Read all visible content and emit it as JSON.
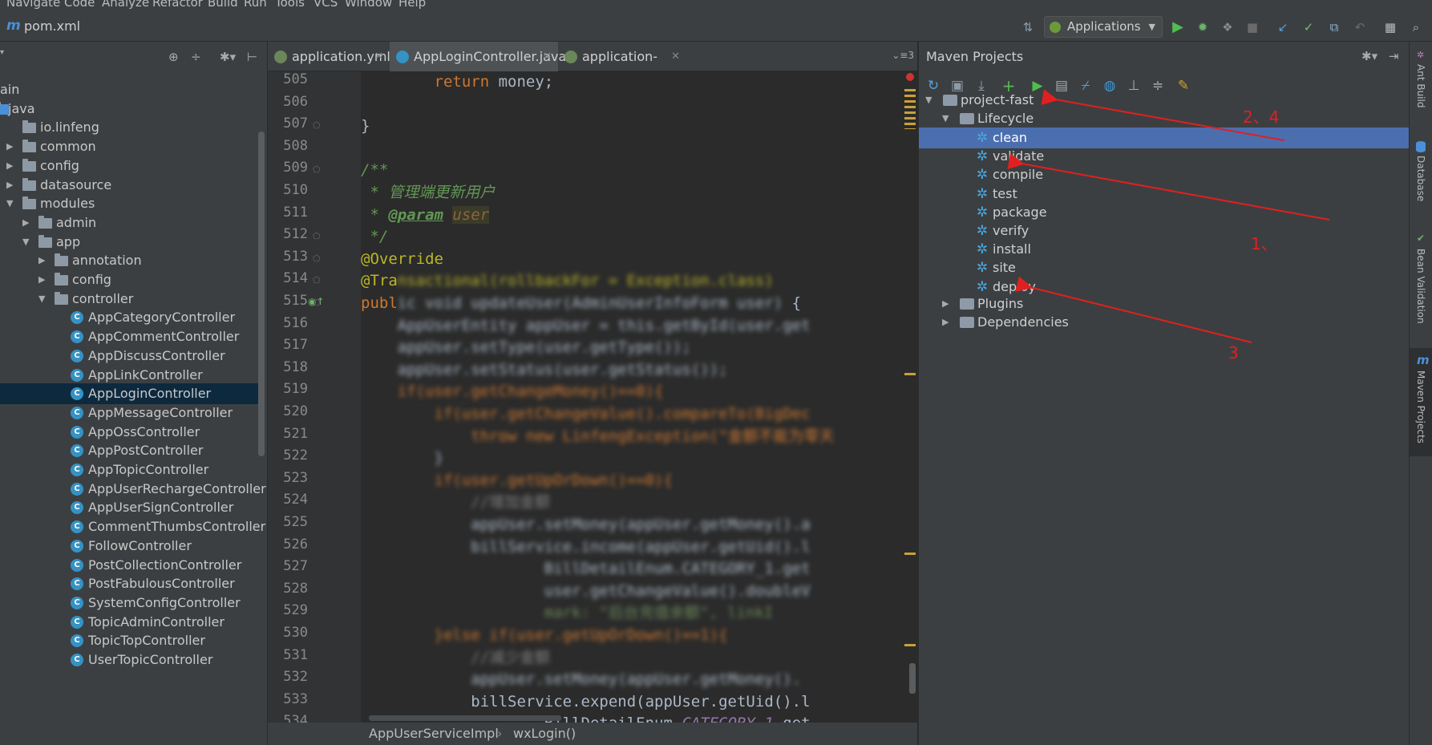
{
  "menu": [
    "Navigate",
    "Code",
    "Analyze",
    "Refactor",
    "Build",
    "Run",
    "Tools",
    "VCS",
    "Window",
    "Help"
  ],
  "navbar": {
    "breadcrumb": "pom.xml",
    "run_config": "Applications"
  },
  "project_tree": [
    {
      "label": "ain",
      "level": 0,
      "type": "text",
      "expanded": null
    },
    {
      "label": "java",
      "level": 0,
      "type": "folder",
      "expanded": null
    },
    {
      "label": "io.linfeng",
      "level": 1,
      "type": "folder",
      "expanded": null
    },
    {
      "label": "common",
      "level": 1,
      "type": "folder",
      "expanded": false
    },
    {
      "label": "config",
      "level": 1,
      "type": "folder",
      "expanded": false
    },
    {
      "label": "datasource",
      "level": 1,
      "type": "folder",
      "expanded": false
    },
    {
      "label": "modules",
      "level": 1,
      "type": "folder",
      "expanded": true
    },
    {
      "label": "admin",
      "level": 2,
      "type": "folder",
      "expanded": false
    },
    {
      "label": "app",
      "level": 2,
      "type": "folder",
      "expanded": true
    },
    {
      "label": "annotation",
      "level": 3,
      "type": "folder",
      "expanded": false
    },
    {
      "label": "config",
      "level": 3,
      "type": "folder",
      "expanded": false
    },
    {
      "label": "controller",
      "level": 3,
      "type": "folder",
      "expanded": true
    },
    {
      "label": "AppCategoryController",
      "level": 4,
      "type": "class"
    },
    {
      "label": "AppCommentController",
      "level": 4,
      "type": "class"
    },
    {
      "label": "AppDiscussController",
      "level": 4,
      "type": "class"
    },
    {
      "label": "AppLinkController",
      "level": 4,
      "type": "class"
    },
    {
      "label": "AppLoginController",
      "level": 4,
      "type": "class",
      "selected": true
    },
    {
      "label": "AppMessageController",
      "level": 4,
      "type": "class"
    },
    {
      "label": "AppOssController",
      "level": 4,
      "type": "class"
    },
    {
      "label": "AppPostController",
      "level": 4,
      "type": "class"
    },
    {
      "label": "AppTopicController",
      "level": 4,
      "type": "class"
    },
    {
      "label": "AppUserRechargeController",
      "level": 4,
      "type": "class"
    },
    {
      "label": "AppUserSignController",
      "level": 4,
      "type": "class"
    },
    {
      "label": "CommentThumbsController",
      "level": 4,
      "type": "class"
    },
    {
      "label": "FollowController",
      "level": 4,
      "type": "class"
    },
    {
      "label": "PostCollectionController",
      "level": 4,
      "type": "class"
    },
    {
      "label": "PostFabulousController",
      "level": 4,
      "type": "class"
    },
    {
      "label": "SystemConfigController",
      "level": 4,
      "type": "class"
    },
    {
      "label": "TopicAdminController",
      "level": 4,
      "type": "class"
    },
    {
      "label": "TopicTopController",
      "level": 4,
      "type": "class"
    },
    {
      "label": "UserTopicController",
      "level": 4,
      "type": "class"
    }
  ],
  "editor_tabs": [
    {
      "label": "application.yml",
      "icon_color": "#6a8759"
    },
    {
      "label": "AppLoginController.java",
      "icon_color": "#3592c4",
      "active": true
    },
    {
      "label": "application-dev.yml",
      "icon_color": "#6a8759"
    }
  ],
  "tab_overflow": "3",
  "line_numbers": [
    505,
    506,
    507,
    508,
    509,
    510,
    511,
    512,
    513,
    514,
    515,
    516,
    517,
    518,
    519,
    520,
    521,
    522,
    523,
    524,
    525,
    526,
    527,
    528,
    529,
    530,
    531,
    532,
    533,
    534
  ],
  "code_lines": [
    {
      "segments": [
        {
          "t": "        return ",
          "c": "#cc7832"
        },
        {
          "t": "money;",
          "c": "#a9b7c6"
        }
      ]
    },
    {
      "segments": []
    },
    {
      "segments": [
        {
          "t": "}",
          "c": "#a9b7c6"
        }
      ]
    },
    {
      "segments": []
    },
    {
      "segments": [
        {
          "t": "/**",
          "c": "#629755",
          "i": true
        }
      ]
    },
    {
      "segments": [
        {
          "t": " * 管理端更新用户",
          "c": "#629755",
          "i": true
        }
      ]
    },
    {
      "segments": [
        {
          "t": " * ",
          "c": "#629755",
          "i": true
        },
        {
          "t": "@param",
          "c": "#629755",
          "i": true,
          "u": true,
          "b": true
        },
        {
          "t": " ",
          "c": "#629755"
        },
        {
          "t": "user",
          "c": "#8a653b",
          "i": true,
          "bg": "#3b3b2a"
        }
      ]
    },
    {
      "segments": [
        {
          "t": " */",
          "c": "#629755",
          "i": true
        }
      ]
    },
    {
      "segments": [
        {
          "t": "@Override",
          "c": "#bbb529"
        }
      ]
    },
    {
      "segments": [
        {
          "t": "@Tra",
          "c": "#bbb529"
        },
        {
          "t": "nsactional(rollbackFor = Exception.class)",
          "c": "#bbb529",
          "blur": true
        }
      ]
    },
    {
      "segments": [
        {
          "t": "publ",
          "c": "#cc7832"
        },
        {
          "t": "ic void updateUser(AdminUserInfoForm user) ",
          "c": "#a9b7c6",
          "blur": true
        },
        {
          "t": "{",
          "c": "#a9b7c6"
        }
      ]
    },
    {
      "segments": [
        {
          "t": "    AppUserEntity appUser = this.getById(user.get",
          "c": "#a9b7c6",
          "blur": true
        }
      ]
    },
    {
      "segments": [
        {
          "t": "    appUser.setType(user.getType());",
          "c": "#a9b7c6",
          "blur": true
        }
      ]
    },
    {
      "segments": [
        {
          "t": "    appUser.setStatus(user.getStatus());",
          "c": "#a9b7c6",
          "blur": true
        }
      ]
    },
    {
      "segments": [
        {
          "t": "    if(user.getChangeMoney()==0){",
          "c": "#cc7832",
          "blur": true
        }
      ]
    },
    {
      "segments": [
        {
          "t": "        if(user.getChangeValue().compareTo(BigDec",
          "c": "#cc7832",
          "blur": true
        }
      ]
    },
    {
      "segments": [
        {
          "t": "            throw new LinfengException(\"金额不能为零天",
          "c": "#cc7832",
          "blur": true
        }
      ]
    },
    {
      "segments": [
        {
          "t": "        }",
          "c": "#a9b7c6",
          "blur": true
        }
      ]
    },
    {
      "segments": [
        {
          "t": "        if(user.getUpOrDown()==0){",
          "c": "#cc7832",
          "blur": true
        }
      ]
    },
    {
      "segments": [
        {
          "t": "            //增加金额",
          "c": "#808080",
          "blur": true
        }
      ]
    },
    {
      "segments": [
        {
          "t": "            appUser.setMoney(appUser.getMoney().a",
          "c": "#a9b7c6",
          "blur": true
        }
      ]
    },
    {
      "segments": [
        {
          "t": "            billService.income(appUser.getUid().l",
          "c": "#a9b7c6",
          "blur": true
        }
      ]
    },
    {
      "segments": [
        {
          "t": "                    BillDetailEnum.CATEGORY_1.get",
          "c": "#a9b7c6",
          "blur": true
        }
      ]
    },
    {
      "segments": [
        {
          "t": "                    user.getChangeValue().doubleV",
          "c": "#a9b7c6",
          "blur": true
        }
      ]
    },
    {
      "segments": [
        {
          "t": "                    mark: \"后台充值余额\", linkI",
          "c": "#6a8759",
          "blur": true
        }
      ]
    },
    {
      "segments": [
        {
          "t": "        }else if(user.getUpOrDown()==1){",
          "c": "#cc7832",
          "blur": true
        }
      ]
    },
    {
      "segments": [
        {
          "t": "            //减少金额",
          "c": "#808080",
          "blur": true
        }
      ]
    },
    {
      "segments": [
        {
          "t": "            appUser.setMoney(appUser.getMoney().",
          "c": "#a9b7c6",
          "blur": true
        }
      ]
    },
    {
      "segments": [
        {
          "t": "            billService.expend(appUser.getUid().l",
          "c": "#a9b7c6"
        }
      ]
    },
    {
      "segments": [
        {
          "t": "                    BillDetailEnum.",
          "c": "#a9b7c6"
        },
        {
          "t": "CATEGORY_1",
          "c": "#9876aa",
          "i": true
        },
        {
          "t": ".get",
          "c": "#a9b7c6"
        }
      ]
    }
  ],
  "breadcrumb_bottom": {
    "class": "AppUserServiceImpl",
    "method": "wxLogin()"
  },
  "maven": {
    "title": "Maven Projects",
    "project": "project-fast",
    "lifecycle_label": "Lifecycle",
    "phases": [
      "clean",
      "validate",
      "compile",
      "test",
      "package",
      "verify",
      "install",
      "site",
      "deploy"
    ],
    "selected_phase": "clean",
    "plugins_label": "Plugins",
    "dependencies_label": "Dependencies"
  },
  "annotations": [
    {
      "text": "2、4"
    },
    {
      "text": "1、"
    },
    {
      "text": "3"
    }
  ],
  "right_strip": [
    "Ant Build",
    "Database",
    "Bean Validation",
    "Maven Projects"
  ],
  "colors": {
    "selection": "#4b6eaf",
    "tree_selection": "#0d293e",
    "annotation": "#e02020"
  }
}
